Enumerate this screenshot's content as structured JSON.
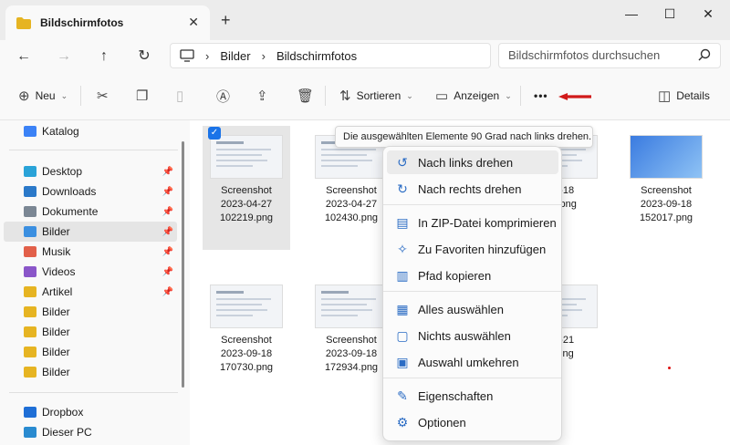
{
  "window": {
    "tab_title": "Bildschirmfotos",
    "tab_close": "✕",
    "new_tab": "+",
    "minimize": "—",
    "maximize": "☐",
    "close": "✕"
  },
  "nav": {
    "back": "←",
    "forward": "→",
    "up": "↑",
    "refresh": "↻",
    "breadcrumb": [
      "Bilder",
      "Bildschirmfotos"
    ],
    "search_placeholder": "Bildschirmfotos durchsuchen"
  },
  "toolbar": {
    "new_label": "Neu",
    "sort_label": "Sortieren",
    "view_label": "Anzeigen",
    "more_label": "•••",
    "details_label": "Details"
  },
  "sidebar": {
    "items": [
      {
        "label": "Katalog",
        "icon": "gallery-icon",
        "color": "#3b82f6"
      },
      {
        "label": "Desktop",
        "icon": "desktop-icon",
        "color": "#2aa3d8",
        "pinned": true
      },
      {
        "label": "Downloads",
        "icon": "download-icon",
        "color": "#2b79c9",
        "pinned": true
      },
      {
        "label": "Dokumente",
        "icon": "document-icon",
        "color": "#7b8794",
        "pinned": true
      },
      {
        "label": "Bilder",
        "icon": "pictures-icon",
        "color": "#3b8fe0",
        "pinned": true,
        "selected": true
      },
      {
        "label": "Musik",
        "icon": "music-icon",
        "color": "#e2604a",
        "pinned": true
      },
      {
        "label": "Videos",
        "icon": "video-icon",
        "color": "#8a56c9",
        "pinned": true
      },
      {
        "label": "Artikel",
        "icon": "folder-icon",
        "color": "#e6b422",
        "pinned": true
      },
      {
        "label": "Bilder",
        "icon": "folder-icon",
        "color": "#e6b422"
      },
      {
        "label": "Bilder",
        "icon": "folder-icon",
        "color": "#e6b422"
      },
      {
        "label": "Bilder",
        "icon": "folder-icon",
        "color": "#e6b422"
      },
      {
        "label": "Bilder",
        "icon": "folder-icon",
        "color": "#e6b422"
      },
      {
        "label": "Dropbox",
        "icon": "dropbox-icon",
        "color": "#1f6fd6"
      },
      {
        "label": "Dieser PC",
        "icon": "pc-icon",
        "color": "#2a8bd0"
      }
    ]
  },
  "files": [
    {
      "l1": "Screenshot",
      "l2": "2023-04-27",
      "l3": "102219.png",
      "selected": true
    },
    {
      "l1": "Screenshot",
      "l2": "2023-04-27",
      "l3": "102430.png"
    },
    {
      "l1": "",
      "l2": "09-18",
      "l3": "27.png"
    },
    {
      "l1": "Screenshot",
      "l2": "2023-09-18",
      "l3": "152017.png"
    },
    {
      "l1": "Screenshot",
      "l2": "2023-09-18",
      "l3": "170730.png"
    },
    {
      "l1": "Screenshot",
      "l2": "2023-09-18",
      "l3": "172934.png"
    },
    {
      "l1": "",
      "l2": "09-21",
      "l3": "0.png"
    }
  ],
  "tooltip": "Die ausgewählten Elemente 90 Grad nach links drehen.",
  "menu": {
    "items": [
      {
        "label": "Nach links drehen",
        "icon": "rotate-left-icon",
        "glyph": "↺"
      },
      {
        "label": "Nach rechts drehen",
        "icon": "rotate-right-icon",
        "glyph": "↻"
      },
      {
        "label": "In ZIP-Datei komprimieren",
        "icon": "zip-icon",
        "glyph": "▤"
      },
      {
        "label": "Zu Favoriten hinzufügen",
        "icon": "pin-icon",
        "glyph": "✧"
      },
      {
        "label": "Pfad kopieren",
        "icon": "copy-path-icon",
        "glyph": "▥"
      },
      {
        "label": "Alles auswählen",
        "icon": "select-all-icon",
        "glyph": "▦"
      },
      {
        "label": "Nichts auswählen",
        "icon": "select-none-icon",
        "glyph": "▢"
      },
      {
        "label": "Auswahl umkehren",
        "icon": "invert-selection-icon",
        "glyph": "▣"
      },
      {
        "label": "Eigenschaften",
        "icon": "properties-icon",
        "glyph": "✎"
      },
      {
        "label": "Optionen",
        "icon": "options-icon",
        "glyph": "⚙"
      }
    ]
  },
  "colors": {
    "accent": "#1a73e8",
    "folder": "#e6b422",
    "arrow": "#d11a1a"
  }
}
